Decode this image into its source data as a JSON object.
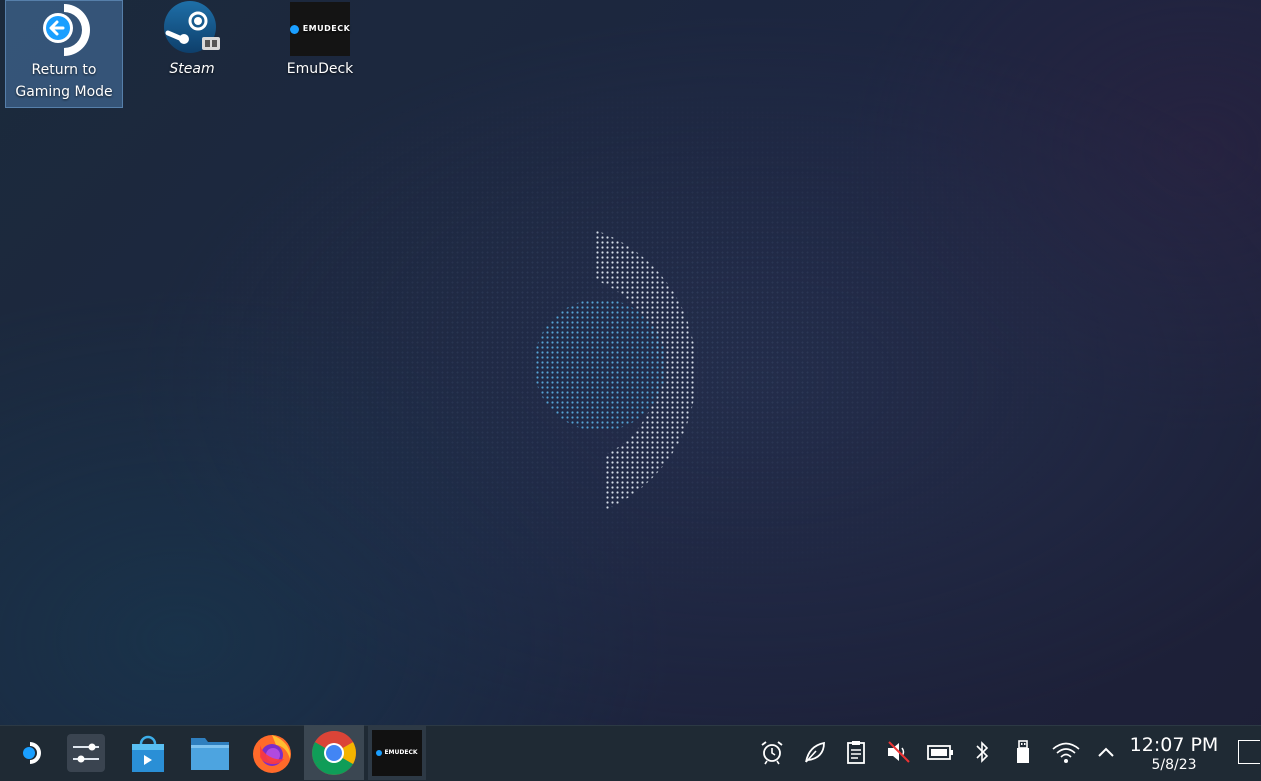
{
  "desktop": {
    "icons": [
      {
        "label": "Return to Gaming Mode",
        "icon": "return-arrow-icon"
      },
      {
        "label": "Steam",
        "icon": "steam-icon"
      },
      {
        "label": "EmuDeck",
        "icon": "emudeck-icon"
      }
    ]
  },
  "emudeck_logo_text": "EMUDECK",
  "taskbar": {
    "launcher_icon": "steamdeck-launcher-icon",
    "apps": [
      {
        "name": "System Settings",
        "icon": "settings-sliders-icon"
      },
      {
        "name": "Discover",
        "icon": "store-bag-icon"
      },
      {
        "name": "Dolphin",
        "icon": "folder-icon"
      },
      {
        "name": "Firefox",
        "icon": "firefox-icon"
      },
      {
        "name": "Google Chrome",
        "icon": "chrome-icon"
      },
      {
        "name": "EmuDeck",
        "icon": "emudeck-icon"
      }
    ],
    "tray": [
      "alarm-icon",
      "leaf-icon",
      "clipboard-icon",
      "speaker-muted-icon",
      "battery-icon",
      "bluetooth-icon",
      "usb-icon",
      "wifi-icon",
      "chevron-up-icon"
    ],
    "clock": {
      "time": "12:07 PM",
      "date": "5/8/23"
    }
  },
  "colors": {
    "accent": "#1a9fff",
    "taskbar": "#1f2a34",
    "selection": "#4a78aa"
  }
}
